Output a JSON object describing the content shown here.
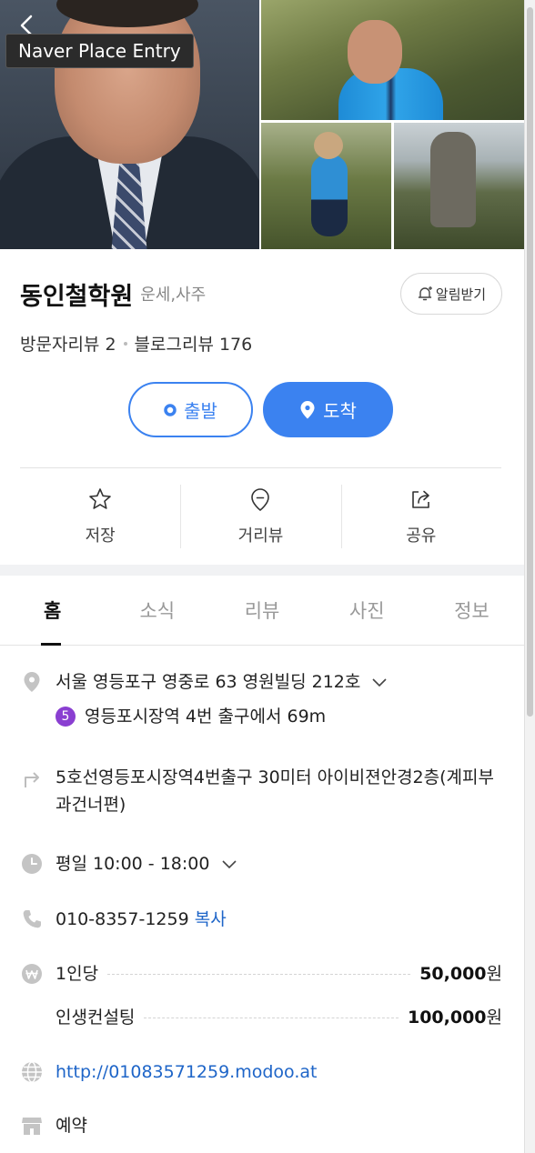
{
  "overlay": {
    "tooltip": "Naver Place Entry"
  },
  "place": {
    "name": "동인철학원",
    "category": "운세,사주",
    "alarm_label": "알림받기",
    "visitor_reviews": "방문자리뷰 2",
    "blog_reviews": "블로그리뷰 176"
  },
  "route": {
    "start_label": "출발",
    "arrive_label": "도착"
  },
  "actions": [
    {
      "label": "저장",
      "icon": "star-icon"
    },
    {
      "label": "거리뷰",
      "icon": "location-pin-icon"
    },
    {
      "label": "공유",
      "icon": "share-icon"
    }
  ],
  "tabs": [
    {
      "label": "홈",
      "active": true
    },
    {
      "label": "소식",
      "active": false
    },
    {
      "label": "리뷰",
      "active": false
    },
    {
      "label": "사진",
      "active": false
    },
    {
      "label": "정보",
      "active": false
    }
  ],
  "details": {
    "address": "서울 영등포구 영중로 63 영원빌딩 212호",
    "subway_line": "5",
    "subway_line_color": "#8a3fd1",
    "subway_text": "영등포시장역 4번 출구에서 69m",
    "directions": "5호선영등포시장역4번출구 30미터 아이비젼안경2층(계피부과건너편)",
    "hours": "평일 10:00 - 18:00",
    "phone": "010-8357-1259",
    "copy_label": "복사",
    "prices": [
      {
        "item": "1인당",
        "amount": "50,000",
        "unit": "원"
      },
      {
        "item": "인생컨설팅",
        "amount": "100,000",
        "unit": "원"
      }
    ],
    "website": "http://01083571259.modoo.at",
    "booking": "예약"
  },
  "colors": {
    "accent": "#3b82f0",
    "link": "#1e65c8"
  }
}
